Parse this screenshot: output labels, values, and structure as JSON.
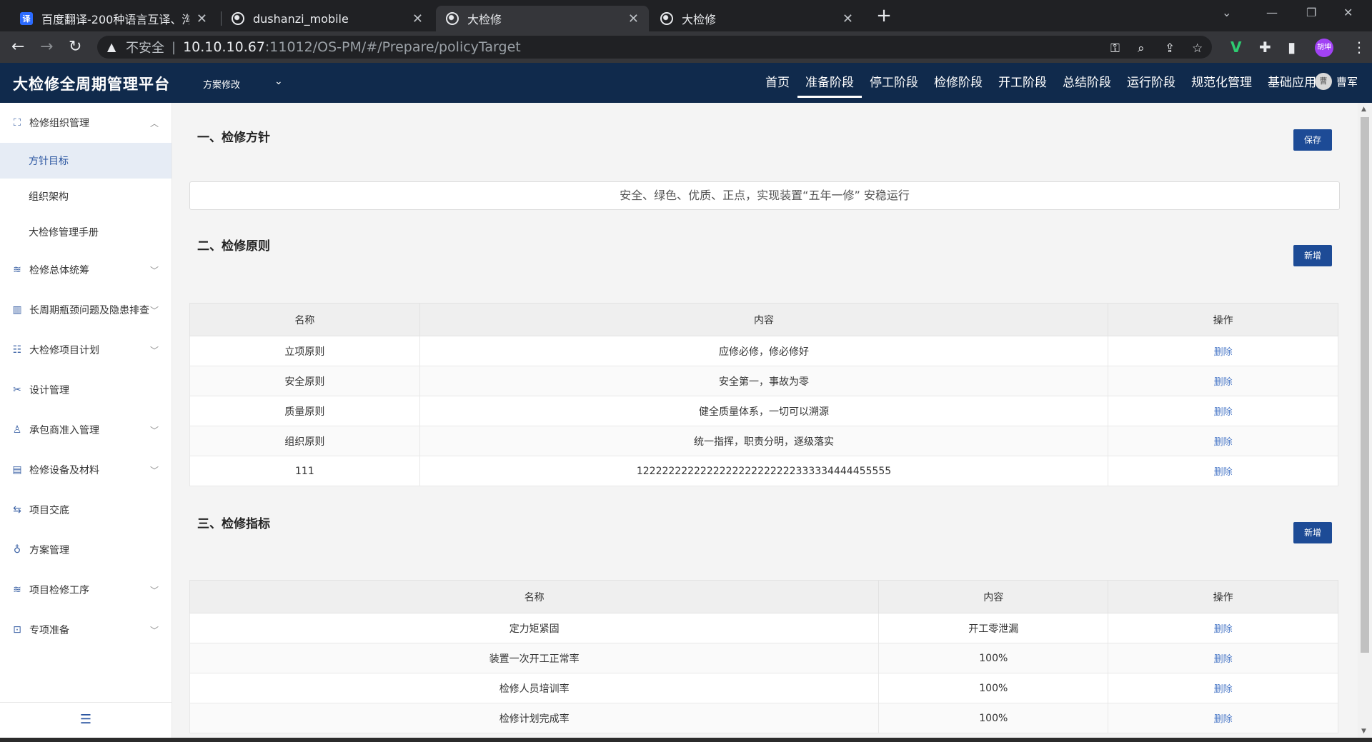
{
  "browser": {
    "tabs": [
      {
        "title": "百度翻译-200种语言互译、沟通",
        "icon": "fanyi-icon",
        "active": false
      },
      {
        "title": "dushanzi_mobile",
        "icon": "globe-icon",
        "active": false
      },
      {
        "title": "大检修",
        "icon": "globe-icon",
        "active": true
      },
      {
        "title": "大检修",
        "icon": "globe-icon",
        "active": false
      }
    ],
    "security_label": "不安全",
    "url_host": "10.10.10.67",
    "url_path": ":11012/OS-PM/#/Prepare/policyTarget",
    "profile_initials": "胡坤"
  },
  "app": {
    "brand": "大检修全周期管理平台",
    "plan_select": "方案修改",
    "nav": [
      {
        "label": "首页",
        "active": false
      },
      {
        "label": "准备阶段",
        "active": true
      },
      {
        "label": "停工阶段",
        "active": false
      },
      {
        "label": "检修阶段",
        "active": false
      },
      {
        "label": "开工阶段",
        "active": false
      },
      {
        "label": "总结阶段",
        "active": false
      },
      {
        "label": "运行阶段",
        "active": false
      },
      {
        "label": "规范化管理",
        "active": false
      },
      {
        "label": "基础应用",
        "active": false
      }
    ],
    "user": {
      "avatar_text": "曹",
      "name": "曹军"
    },
    "accent_color": "#1d4b96",
    "header_color": "#102a4c"
  },
  "sidebar": {
    "items": [
      {
        "label": "检修组织管理",
        "icon": "org-icon",
        "expanded": true,
        "children": [
          "方针目标",
          "组织架构",
          "大检修管理手册"
        ],
        "active_child": "方针目标"
      },
      {
        "label": "检修总体统筹",
        "icon": "layers-icon"
      },
      {
        "label": "长周期瓶颈问题及隐患排查",
        "icon": "chart-icon"
      },
      {
        "label": "大检修项目计划",
        "icon": "plan-icon"
      },
      {
        "label": "设计管理",
        "icon": "tools-icon"
      },
      {
        "label": "承包商准入管理",
        "icon": "person-icon"
      },
      {
        "label": "检修设备及材料",
        "icon": "library-icon"
      },
      {
        "label": "项目交底",
        "icon": "handover-icon"
      },
      {
        "label": "方案管理",
        "icon": "bulb-icon"
      },
      {
        "label": "项目检修工序",
        "icon": "layers-icon"
      },
      {
        "label": "专项准备",
        "icon": "toolbox-icon"
      }
    ]
  },
  "sections": {
    "policy": {
      "title": "一、检修方针",
      "save_label": "保存",
      "text": "安全、绿色、优质、正点，实现装置“五年一修” 安稳运行"
    },
    "principles": {
      "title": "二、检修原则",
      "add_label": "新增",
      "columns": [
        "名称",
        "内容",
        "操作"
      ],
      "rows": [
        {
          "name": "立项原则",
          "content": "应修必修，修必修好",
          "op": "删除"
        },
        {
          "name": "安全原则",
          "content": "安全第一，事故为零",
          "op": "删除"
        },
        {
          "name": "质量原则",
          "content": "健全质量体系，一切可以溯源",
          "op": "删除"
        },
        {
          "name": "组织原则",
          "content": "统一指挥，职责分明，逐级落实",
          "op": "删除"
        },
        {
          "name": "111",
          "content": "1222222222222222222222222333334444455555",
          "op": "删除"
        }
      ]
    },
    "indicators": {
      "title": "三、检修指标",
      "add_label": "新增",
      "columns": [
        "名称",
        "内容",
        "操作"
      ],
      "rows": [
        {
          "name": "定力矩紧固",
          "content": "开工零泄漏",
          "op": "删除"
        },
        {
          "name": "装置一次开工正常率",
          "content": "100%",
          "op": "删除"
        },
        {
          "name": "检修人员培训率",
          "content": "100%",
          "op": "删除"
        },
        {
          "name": "检修计划完成率",
          "content": "100%",
          "op": "删除"
        }
      ]
    }
  }
}
